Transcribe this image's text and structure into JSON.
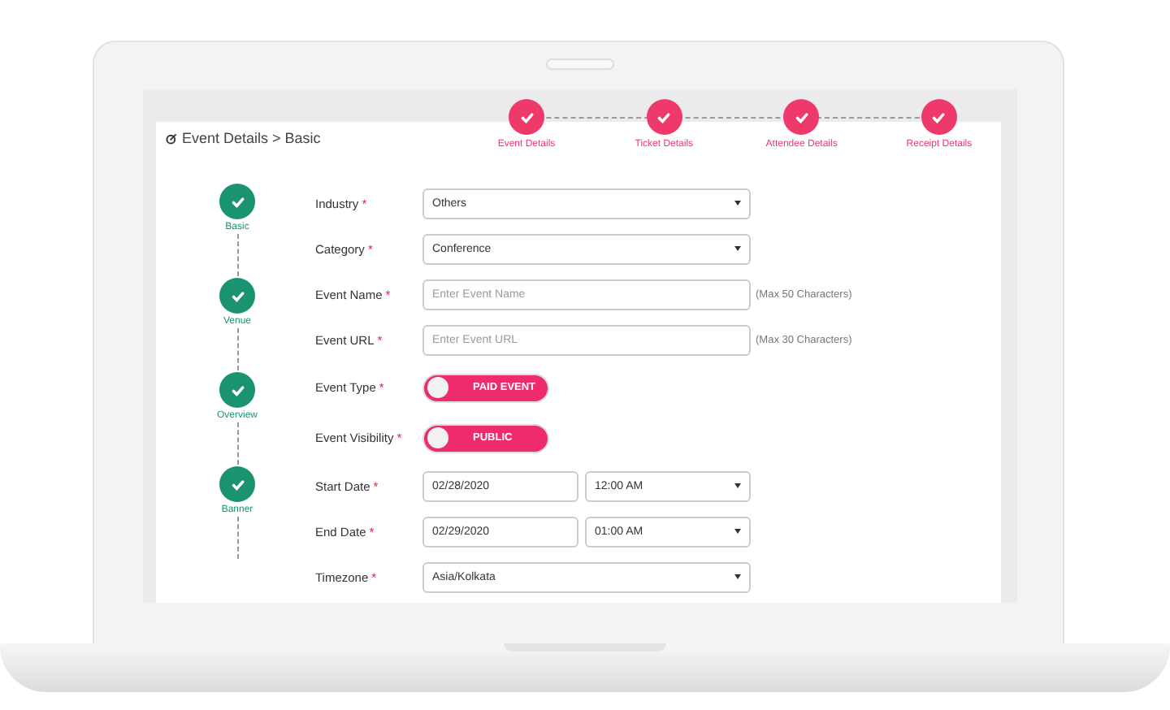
{
  "header": {
    "title": "Event Details > Basic"
  },
  "top_steps": [
    {
      "label": "Event Details",
      "completed": true
    },
    {
      "label": "Ticket Details",
      "completed": true
    },
    {
      "label": "Attendee Details",
      "completed": true
    },
    {
      "label": "Receipt Details",
      "completed": true
    }
  ],
  "side_steps": [
    {
      "label": "Basic",
      "completed": true
    },
    {
      "label": "Venue",
      "completed": true
    },
    {
      "label": "Overview",
      "completed": true
    },
    {
      "label": "Banner",
      "completed": true
    }
  ],
  "fields": [
    {
      "kind": "select",
      "label": "Industry",
      "mark": "*",
      "value": "Others"
    },
    {
      "kind": "select",
      "label": "Category",
      "mark": "*",
      "value": "Conference"
    },
    {
      "kind": "input",
      "label": "Event Name",
      "mark": "*",
      "placeholder": "Enter Event Name",
      "hint": "(Max 50 Characters)"
    },
    {
      "kind": "input",
      "label": "Event URL",
      "mark": "*",
      "placeholder": "Enter Event URL",
      "hint": "(Max 30 Characters)"
    },
    {
      "kind": "toggle",
      "label": "Event Type",
      "mark": "*",
      "text": "PAID EVENT",
      "on": false
    },
    {
      "kind": "toggle",
      "label": "Event Visibility",
      "mark": "*",
      "text": "PUBLIC",
      "on": false
    },
    {
      "kind": "datetime",
      "label": "Start Date",
      "mark": "*",
      "date": "02/28/2020",
      "time": "12:00 AM"
    },
    {
      "kind": "datetime",
      "label": "End Date",
      "mark": "*",
      "date": "02/29/2020",
      "time": "01:00 AM"
    },
    {
      "kind": "select",
      "label": "Timezone",
      "mark": "*",
      "value": "Asia/Kolkata"
    }
  ]
}
